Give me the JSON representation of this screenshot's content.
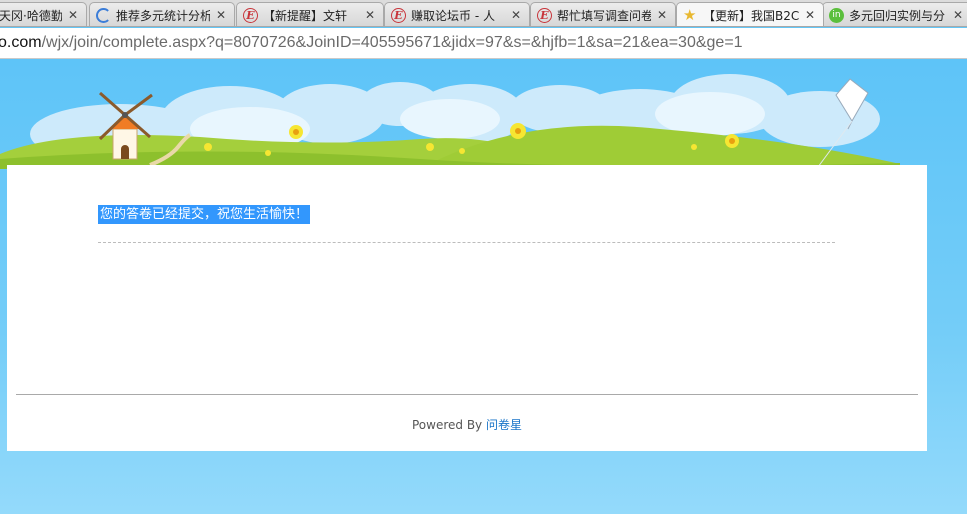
{
  "tabs": [
    {
      "label": "天冈·哈德勤",
      "icon": "page-icon",
      "active": false
    },
    {
      "label": "推荐多元统计分析",
      "icon": "loading-spinner-icon",
      "active": false
    },
    {
      "label": "【新提醒】文轩",
      "icon": "e-logo-icon",
      "active": false
    },
    {
      "label": "赚取论坛币 - 人",
      "icon": "e-logo-icon",
      "active": false
    },
    {
      "label": "帮忙填写调查问卷",
      "icon": "e-logo-icon",
      "active": false
    },
    {
      "label": "【更新】我国B2C",
      "icon": "star-icon",
      "active": true
    },
    {
      "label": "多元回归实例与分",
      "icon": "green-logo-icon",
      "active": false
    }
  ],
  "tab_close_glyph": "✕",
  "address": {
    "domain_tail": "o.com",
    "path": "/wjx/join/complete.aspx?q=8070726&JoinID=405595671&jidx=97&s=&hjfb=1&sa=21&ea=30&ge=1"
  },
  "page": {
    "message": "您的答卷已经提交，祝您生活愉快！",
    "powered_prefix": "Powered By",
    "powered_link": "问卷星"
  },
  "colors": {
    "sky": "#63c6f6",
    "selection": "#3297fd",
    "link": "#1a75c8"
  }
}
